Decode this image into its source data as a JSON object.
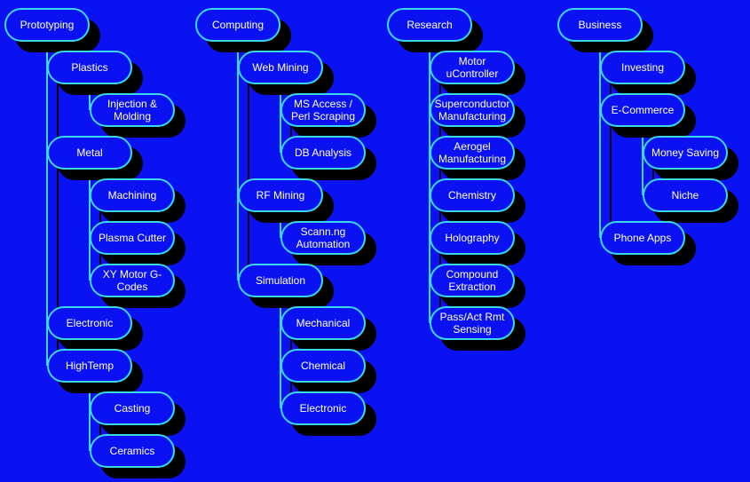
{
  "colors": {
    "background": "#0a12f2",
    "node_border": "#3ad8ea",
    "connector": "#3ad8ea",
    "shadow": "#000000",
    "text": "#ffffff"
  },
  "trees": [
    {
      "label": "Prototyping",
      "children": [
        {
          "label": "Plastics",
          "children": [
            {
              "label": "Injection &\nMolding"
            }
          ]
        },
        {
          "label": "Metal",
          "children": [
            {
              "label": "Machining"
            },
            {
              "label": "Plasma Cutter"
            },
            {
              "label": "XY Motor G-\nCodes"
            }
          ]
        },
        {
          "label": "Electronic"
        },
        {
          "label": "HighTemp",
          "children": [
            {
              "label": "Casting"
            },
            {
              "label": "Ceramics"
            }
          ]
        }
      ]
    },
    {
      "label": "Computing",
      "children": [
        {
          "label": "Web Mining",
          "children": [
            {
              "label": "MS Access /\nPerl Scraping"
            },
            {
              "label": "DB Analysis"
            }
          ]
        },
        {
          "label": "RF Mining",
          "children": [
            {
              "label": "Scann.ng\nAutomation"
            }
          ]
        },
        {
          "label": "Simulation",
          "children": [
            {
              "label": "Mechanical"
            },
            {
              "label": "Chemical"
            },
            {
              "label": "Electronic"
            }
          ]
        }
      ]
    },
    {
      "label": "Research",
      "children": [
        {
          "label": "Motor\nuController"
        },
        {
          "label": "Superconductor\nManufacturing"
        },
        {
          "label": "Aerogel\nManufacturing"
        },
        {
          "label": "Chemistry"
        },
        {
          "label": "Holography"
        },
        {
          "label": "Compound\nExtraction"
        },
        {
          "label": "Pass/Act Rmt\nSensing"
        }
      ]
    },
    {
      "label": "Business",
      "children": [
        {
          "label": "Investing"
        },
        {
          "label": "E-Commerce",
          "children": [
            {
              "label": "Money Saving"
            },
            {
              "label": "Niche"
            }
          ]
        },
        {
          "label": "Phone Apps"
        }
      ]
    }
  ]
}
